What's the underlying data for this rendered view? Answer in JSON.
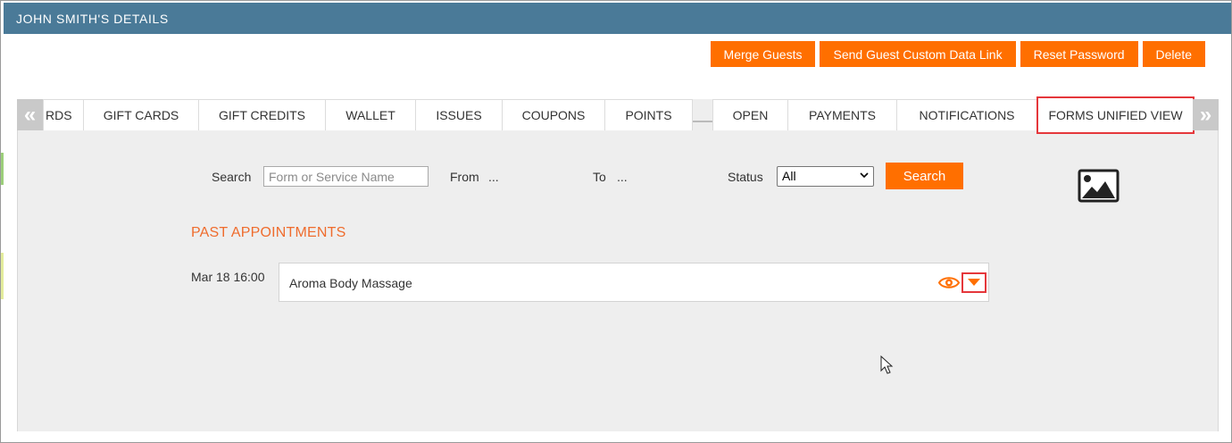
{
  "window": {
    "title": "JOHN SMITH'S DETAILS"
  },
  "actions": [
    {
      "id": "merge",
      "label": "Merge Guests"
    },
    {
      "id": "send-link",
      "label": "Send Guest Custom Data Link"
    },
    {
      "id": "reset",
      "label": "Reset Password"
    },
    {
      "id": "delete",
      "label": "Delete"
    }
  ],
  "tabs": {
    "prev_icon": "double-chevron-left",
    "next_icon": "double-chevron-right",
    "items": [
      "RDS",
      "GIFT CARDS",
      "GIFT CREDITS",
      "WALLET",
      "ISSUES",
      "COUPONS",
      "POINTS",
      "OPEN",
      "PAYMENTS",
      "NOTIFICATIONS",
      "FORMS UNIFIED VIEW"
    ],
    "active": "FORMS UNIFIED VIEW"
  },
  "filters": {
    "search_label": "Search",
    "search_placeholder": "Form or Service Name",
    "search_value": "",
    "from_label": "From",
    "from_value": "...",
    "to_label": "To",
    "to_value": "...",
    "status_label": "Status",
    "status_value": "All",
    "search_button": "Search"
  },
  "section": {
    "title": "PAST APPOINTMENTS",
    "appointments": [
      {
        "time": "Mar 18 16:00",
        "name": "Aroma Body Massage"
      }
    ]
  },
  "colors": {
    "header": "#4a7a98",
    "accent": "#ff6f00",
    "section_title": "#ef6c2d",
    "highlight": "#e5373b"
  },
  "icons": [
    "image-icon",
    "eye-icon",
    "caret-down-icon",
    "mouse-cursor-icon"
  ]
}
